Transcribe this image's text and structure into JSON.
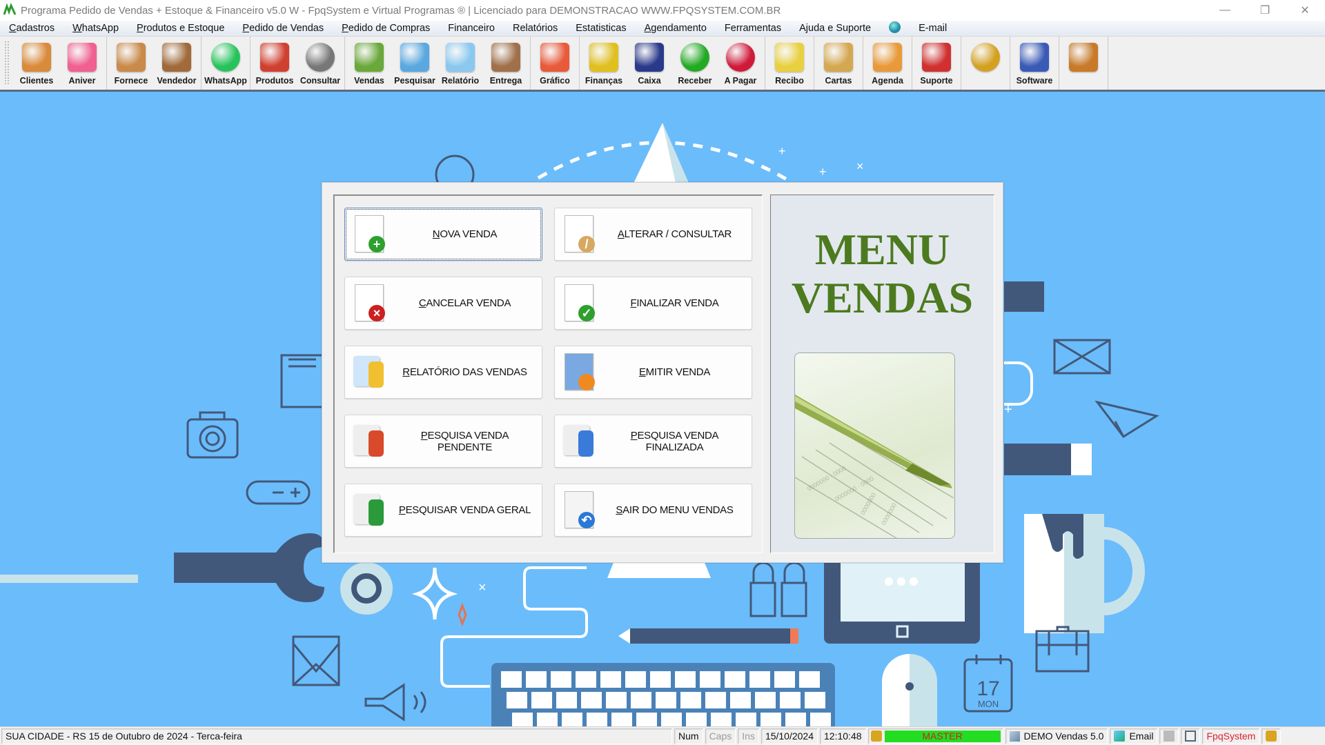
{
  "window": {
    "title": "Programa Pedido de Vendas + Estoque & Financeiro v5.0 W - FpqSystem e Virtual Programas ® | Licenciado para  DEMONSTRACAO WWW.FPQSYSTEM.COM.BR",
    "controls": {
      "minimize": "—",
      "restore": "❐",
      "close": "✕"
    }
  },
  "menubar": [
    {
      "label": "Cadastros",
      "accel": "C"
    },
    {
      "label": "WhatsApp",
      "accel": "W"
    },
    {
      "label": "Produtos e Estoque",
      "accel": "P"
    },
    {
      "label": "Pedido de Vendas",
      "accel": "P"
    },
    {
      "label": "Pedido de Compras",
      "accel": "P"
    },
    {
      "label": "Financeiro",
      "accel": ""
    },
    {
      "label": "Relatórios",
      "accel": ""
    },
    {
      "label": "Estatisticas",
      "accel": ""
    },
    {
      "label": "Agendamento",
      "accel": "A"
    },
    {
      "label": "Ferramentas",
      "accel": ""
    },
    {
      "label": "Ajuda e Suporte",
      "accel": ""
    },
    {
      "label": "",
      "icon": "globe-icon"
    },
    {
      "label": "E-mail",
      "accel": ""
    }
  ],
  "toolbar": {
    "groups": [
      [
        {
          "label": "Clientes",
          "icon": "clients-icon"
        },
        {
          "label": "Aniver",
          "icon": "birthday-cake-icon"
        }
      ],
      [
        {
          "label": "Fornece",
          "icon": "supplier-icon"
        },
        {
          "label": "Vendedor",
          "icon": "salesperson-icon"
        }
      ],
      [
        {
          "label": "WhatsApp",
          "icon": "whatsapp-icon"
        }
      ],
      [
        {
          "label": "Produtos",
          "icon": "products-cart-icon"
        },
        {
          "label": "Consultar",
          "icon": "barcode-icon"
        }
      ],
      [
        {
          "label": "Vendas",
          "icon": "shopping-cart-icon"
        },
        {
          "label": "Pesquisar",
          "icon": "search-documents-icon"
        },
        {
          "label": "Relatório",
          "icon": "printer-icon"
        },
        {
          "label": "Entrega",
          "icon": "hand-truck-icon"
        }
      ],
      [
        {
          "label": "Gráfico",
          "icon": "bar-chart-icon"
        }
      ],
      [
        {
          "label": "Finanças",
          "icon": "finance-pie-icon"
        },
        {
          "label": "Caixa",
          "icon": "cashbook-icon"
        },
        {
          "label": "Receber",
          "icon": "receive-money-icon"
        },
        {
          "label": "A Pagar",
          "icon": "pay-money-icon"
        }
      ],
      [
        {
          "label": "Recibo",
          "icon": "receipt-icon"
        }
      ],
      [
        {
          "label": "Cartas",
          "icon": "parchment-icon"
        }
      ],
      [
        {
          "label": "Agenda",
          "icon": "calendar-clock-icon"
        }
      ],
      [
        {
          "label": "Suporte",
          "icon": "support-headset-icon"
        }
      ],
      [
        {
          "label": "",
          "icon": "coin-icon"
        }
      ],
      [
        {
          "label": "Software",
          "icon": "software-monitor-icon"
        }
      ],
      [
        {
          "label": "",
          "icon": "exit-door-icon"
        }
      ]
    ]
  },
  "dialog": {
    "title_line1": "MENU",
    "title_line2": "VENDAS",
    "buttons": [
      {
        "label": "NOVA VENDA",
        "icon": "new-document-plus-icon",
        "focused": true
      },
      {
        "label": "ALTERAR / CONSULTAR",
        "icon": "edit-document-pencil-icon"
      },
      {
        "label": "CANCELAR VENDA",
        "icon": "cancel-document-icon"
      },
      {
        "label": "FINALIZAR VENDA",
        "icon": "finalize-document-check-icon"
      },
      {
        "label": "RELATÓRIO DAS VENDAS",
        "icon": "printer-icon"
      },
      {
        "label": "EMITIR VENDA",
        "icon": "issue-document-person-icon"
      },
      {
        "label": "PESQUISA VENDA PENDENTE",
        "icon": "chart-search-icon"
      },
      {
        "label": "PESQUISA VENDA FINALIZADA",
        "icon": "chart-binoculars-icon"
      },
      {
        "label": "PESQUISAR VENDA GERAL",
        "icon": "chart-magnifier-icon"
      },
      {
        "label": "SAIR DO MENU VENDAS",
        "icon": "exit-window-icon"
      }
    ]
  },
  "statusbar": {
    "location_date": "SUA CIDADE - RS 15 de Outubro de 2024 - Terca-feira",
    "num": "Num",
    "caps": "Caps",
    "ins": "Ins",
    "date": "15/10/2024",
    "time": "12:10:48",
    "user": "MASTER",
    "version": "DEMO Vendas 5.0",
    "email": "Email",
    "brand": "FpqSystem"
  },
  "colors": {
    "desktop_bg": "#6bbcfb",
    "title_green": "#4d7a1f",
    "user_badge_bg": "#22dd22",
    "user_text": "#d02020",
    "brand_red": "#e0202a"
  }
}
